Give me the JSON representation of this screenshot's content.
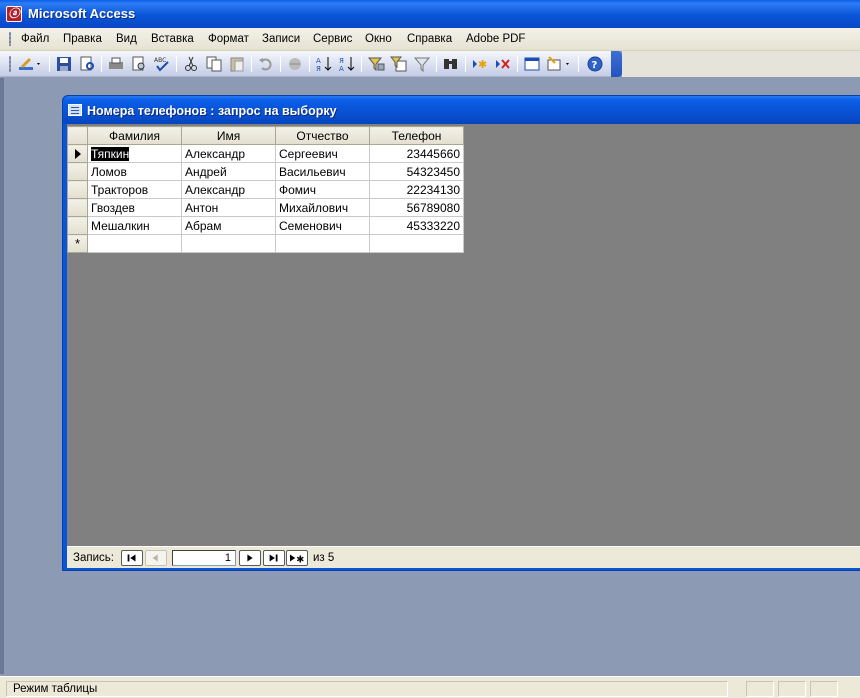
{
  "app": {
    "title": "Microsoft Access"
  },
  "menu": [
    {
      "label": "Файл"
    },
    {
      "label": "Правка"
    },
    {
      "label": "Вид"
    },
    {
      "label": "Вставка"
    },
    {
      "label": "Формат"
    },
    {
      "label": "Записи"
    },
    {
      "label": "Сервис"
    },
    {
      "label": "Окно"
    },
    {
      "label": "Справка"
    },
    {
      "label": "Adobe PDF"
    }
  ],
  "toolbar_icons": [
    "design-view",
    "save",
    "file-search",
    "print",
    "print-preview",
    "spelling",
    "cut",
    "copy",
    "paste",
    "undo",
    "hyperlink",
    "sort-ascending",
    "sort-descending",
    "filter-by-selection",
    "filter-by-form",
    "apply-filter",
    "find",
    "new-record",
    "delete-record",
    "database-window",
    "new-object",
    "help"
  ],
  "query_window": {
    "title": "Номера телефонов : запрос на выборку",
    "columns": [
      "Фамилия",
      "Имя",
      "Отчество",
      "Телефон"
    ],
    "rows": [
      [
        "Тяпкин",
        "Александр",
        "Сергеевич",
        "23445660"
      ],
      [
        "Ломов",
        "Андрей",
        "Васильевич",
        "54323450"
      ],
      [
        "Тракторов",
        "Александр",
        "Фомич",
        "22234130"
      ],
      [
        "Гвоздев",
        "Антон",
        "Михайлович",
        "56789080"
      ],
      [
        "Мешалкин",
        "Абрам",
        "Семенович",
        "45333220"
      ]
    ],
    "new_row_marker": "*",
    "navigation": {
      "label": "Запись:",
      "current": "1",
      "of_label": "из 5"
    }
  },
  "status": {
    "text": "Режим таблицы"
  }
}
